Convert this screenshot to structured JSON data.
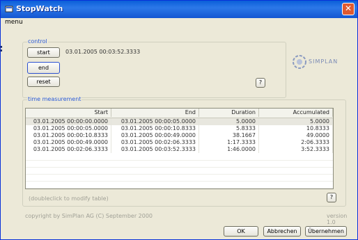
{
  "window": {
    "title": "StopWatch",
    "menu": "menu",
    "side_mark": ":"
  },
  "control": {
    "legend": "control",
    "start_label": "start",
    "end_label": "end",
    "reset_label": "reset",
    "timestamp": "03.01.2005 00:03:52.3333",
    "help_label": "?",
    "logo_text": "SIMPLAN"
  },
  "time": {
    "legend": "time measurement",
    "columns": [
      "Start",
      "End",
      "Duration",
      "Accumulated"
    ],
    "rows": [
      [
        "03.01.2005 00:00:00.0000",
        "03.01.2005 00:00:05.0000",
        "5.0000",
        "5.0000"
      ],
      [
        "03.01.2005 00:00:05.0000",
        "03.01.2005 00:00:10.8333",
        "5.8333",
        "10.8333"
      ],
      [
        "03.01.2005 00:00:10.8333",
        "03.01.2005 00:00:49.0000",
        "38.1667",
        "49.0000"
      ],
      [
        "03.01.2005 00:00:49.0000",
        "03.01.2005 00:02:06.3333",
        "1:17.3333",
        "2:06.3333"
      ],
      [
        "03.01.2005 00:02:06.3333",
        "03.01.2005 00:03:52.3333",
        "1:46.0000",
        "3:52.3333"
      ]
    ],
    "hint": "(doubleclick to modify table)",
    "help_label": "?"
  },
  "footer": {
    "copyright": "copyright by SimPlan AG (C) September 2000",
    "version": "version 1.0",
    "ok_label": "OK",
    "cancel_label": "Abbrechen",
    "apply_label": "Übernehmen"
  },
  "colors": {
    "titlebar": "#0a5fd8",
    "legend": "#2a5ad8",
    "window_bg": "#ece9d8"
  }
}
